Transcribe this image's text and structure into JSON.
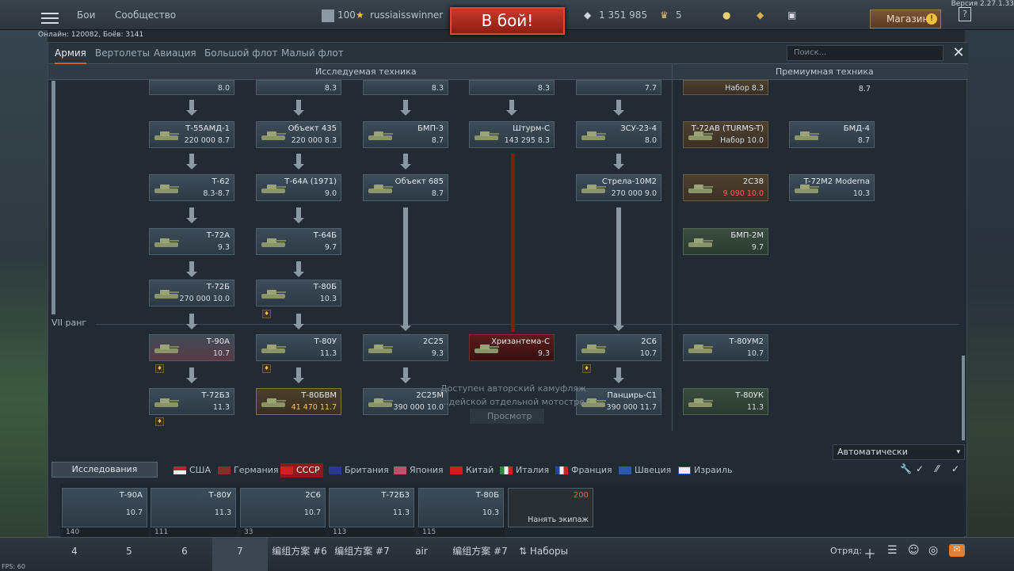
{
  "version": "Версия 2.27.1.33",
  "online": "Онлайн: 120082, Боёв: 3141",
  "fps": "FPS: 60",
  "topbar": {
    "battles": "Бои",
    "community": "Сообщество",
    "rank": "100",
    "username": "russiaisswinner",
    "battle_button": "В бой!",
    "silver": "1 351 985",
    "eagles": "5",
    "shop": "Магазин"
  },
  "tabs": [
    "Армия",
    "Вертолеты",
    "Авиация",
    "Большой флот",
    "Малый флот"
  ],
  "search_placeholder": "Поиск...",
  "headers": {
    "researched": "Исследуемая техника",
    "premium": "Премиумная техника"
  },
  "rank_label": "VII ранг",
  "cards": {
    "c1_1": {
      "name": "",
      "val": "8.0"
    },
    "c1_2": {
      "name": "",
      "val": "8.3"
    },
    "c1_3": {
      "name": "",
      "val": "8.3"
    },
    "c1_4": {
      "name": "",
      "val": "8.3"
    },
    "c1_5": {
      "name": "",
      "val": "7.7"
    },
    "p1_1": {
      "name": "",
      "val": "Набор 8.3"
    },
    "p1_2": {
      "name": "",
      "val": "8.7"
    },
    "t55": {
      "name": "Т-55АМД-1",
      "val": "220 000 8.7"
    },
    "o435": {
      "name": "Объект 435",
      "val": "220 000 8.3"
    },
    "bmp3": {
      "name": "БМП-3",
      "val": "8.7"
    },
    "shturm": {
      "name": "Штурм-С",
      "val": "143 295 8.3"
    },
    "zsu": {
      "name": "ЗСУ-23-4",
      "val": "8.0"
    },
    "t72av": {
      "name": "Т-72АВ (TURMS-T)",
      "val": "Набор 10.0"
    },
    "bmd4": {
      "name": "БМД-4",
      "val": "8.7"
    },
    "t62": {
      "name": "Т-62",
      "val": "8.3-8.7"
    },
    "t64a": {
      "name": "Т-64А (1971)",
      "val": "9.0"
    },
    "o685": {
      "name": "Объект 685",
      "val": "8.7"
    },
    "strela": {
      "name": "Стрела-10М2",
      "val": "270 000 9.0"
    },
    "2s38": {
      "name": "2С38",
      "val": "9 090 10.0"
    },
    "t72m2": {
      "name": "T-72M2 Moderna",
      "val": "10.3"
    },
    "t72a": {
      "name": "Т-72А",
      "val": "9.3"
    },
    "t64b": {
      "name": "Т-64Б",
      "val": "9.7"
    },
    "bmp2m": {
      "name": "БМП-2М",
      "val": "9.7"
    },
    "t72b": {
      "name": "Т-72Б",
      "val": "270 000 10.0"
    },
    "t80b": {
      "name": "Т-80Б",
      "val": "10.3"
    },
    "t90a": {
      "name": "Т-90А",
      "val": "10.7"
    },
    "t80u": {
      "name": "Т-80У",
      "val": "11.3"
    },
    "2s25": {
      "name": "2С25",
      "val": "9.3"
    },
    "hriz": {
      "name": "Хризантема-С",
      "val": "9.3"
    },
    "2s6": {
      "name": "2С6",
      "val": "10.7"
    },
    "t80um2": {
      "name": "Т-80УМ2",
      "val": "10.7"
    },
    "t72b3": {
      "name": "Т-72Б3",
      "val": "11.3"
    },
    "t80bvm": {
      "name": "Т-80БВМ",
      "val": "41 470 11.7"
    },
    "2s25m": {
      "name": "2С25М",
      "val": "390 000 10.0"
    },
    "pantsir": {
      "name": "Панцирь-С1",
      "val": "390 000 11.7"
    },
    "t80uk": {
      "name": "Т-80УК",
      "val": "11.3"
    }
  },
  "camo_text": [
    "Доступен авторский камуфляж",
    "...дейской отдельной мотострел..."
  ],
  "view_button": "Просмотр",
  "auto_select": "Автоматически",
  "research_button": "Исследования",
  "nations": [
    "США",
    "Германия",
    "СССР",
    "Британия",
    "Япония",
    "Китай",
    "Италия",
    "Франция",
    "Швеция",
    "Израиль"
  ],
  "crew": [
    {
      "name": "Т-90А",
      "br": "10.7",
      "num": "140"
    },
    {
      "name": "Т-80У",
      "br": "11.3",
      "num": "111"
    },
    {
      "name": "2С6",
      "br": "10.7",
      "num": "33"
    },
    {
      "name": "Т-72Б3",
      "br": "11.3",
      "num": "113"
    },
    {
      "name": "Т-80Б",
      "br": "10.3",
      "num": "115"
    }
  ],
  "hire": {
    "cost": "200",
    "label": "Нанять экипаж"
  },
  "bottom_tabs": [
    "4",
    "5",
    "6",
    "7",
    "编组方案 #6",
    "编组方案 #7",
    "air",
    "编组方案 #7",
    "Наборы"
  ],
  "squad": "Отряд:"
}
